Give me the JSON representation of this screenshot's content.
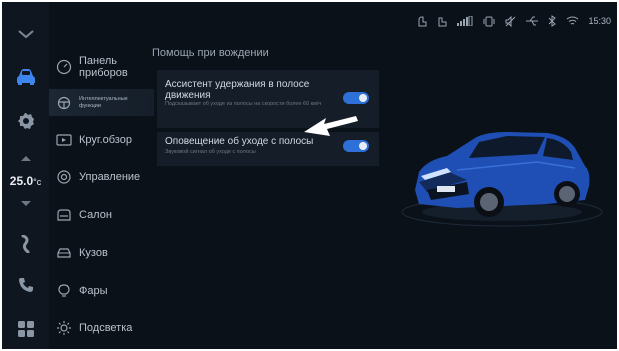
{
  "status_bar": {
    "icons": [
      "seat-heat-icon",
      "seat-vent-icon",
      "signal-bars-icon",
      "vibration-icon",
      "mute-icon",
      "usb-icon",
      "bluetooth-icon",
      "wifi-icon"
    ],
    "time": "15:30"
  },
  "rail": {
    "temperature": "25.0",
    "temperature_unit": "°c",
    "icons": [
      "collapse-chevron-icon",
      "car-icon",
      "settings-gear-icon",
      "temp-up-icon",
      "temp-down-icon",
      "fan-icon",
      "phone-icon",
      "apps-grid-icon"
    ]
  },
  "menu": {
    "items": [
      {
        "label": "Панель приборов",
        "icon": "gauge-icon"
      },
      {
        "label": "Интеллектуальные функции",
        "icon": "smart-steering-icon",
        "active": true
      },
      {
        "label": "Круг.обзор",
        "icon": "camera-icon"
      },
      {
        "label": "Управление",
        "icon": "steering-wheel-icon"
      },
      {
        "label": "Салон",
        "icon": "seat-icon"
      },
      {
        "label": "Кузов",
        "icon": "car-body-icon"
      },
      {
        "label": "Фары",
        "icon": "headlight-icon"
      },
      {
        "label": "Подсветка",
        "icon": "ambient-light-icon"
      }
    ]
  },
  "content": {
    "title": "Помощь при вождении",
    "settings": [
      {
        "title": "Ассистент удержания в полосе движения",
        "subtitle": "Подсказывает об уходе из полосы на скорости более 60 км/ч",
        "enabled": true
      },
      {
        "title": "Оповещение об уходе с полосы",
        "subtitle": "Звуковой сигнал об уходе с полосы",
        "enabled": true
      }
    ]
  },
  "colors": {
    "background": "#0b1118",
    "accent": "#2e6fd8",
    "car": "#1f4fb5"
  }
}
